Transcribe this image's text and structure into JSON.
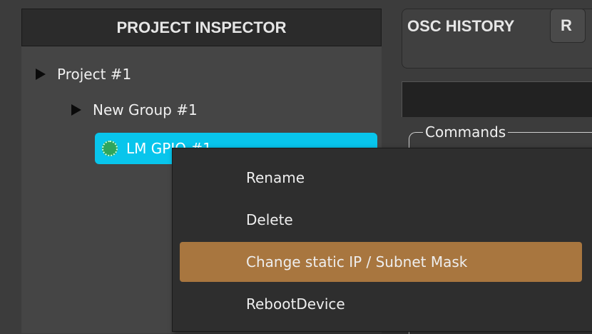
{
  "inspector": {
    "title": "PROJECT INSPECTOR",
    "tree": {
      "project": "Project #1",
      "group": "New Group #1",
      "device": "LM GPIO #1"
    }
  },
  "right_panel": {
    "tab_active": "OSC HISTORY",
    "tab_next": "R",
    "commands_label": "Commands"
  },
  "context_menu": {
    "items": [
      {
        "label": "Rename"
      },
      {
        "label": "Delete"
      },
      {
        "label": "Change static IP / Subnet Mask"
      },
      {
        "label": "RebootDevice"
      }
    ],
    "highlighted_index": 2
  },
  "colors": {
    "selection": "#08c5ec",
    "menu_highlight": "#a8763f",
    "status_dot": "#2ea55c"
  },
  "icons": [
    "expand-triangle-icon",
    "device-status-dot-icon"
  ]
}
